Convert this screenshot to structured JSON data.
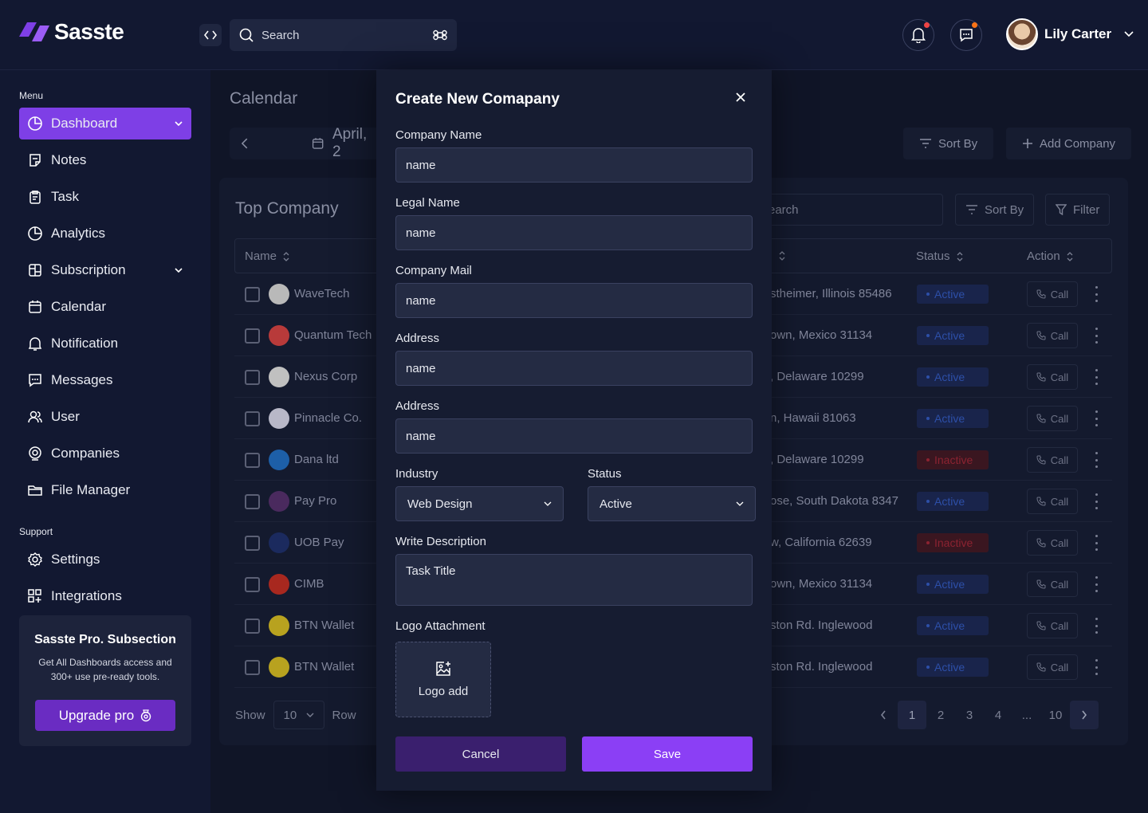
{
  "brand": {
    "name": "Sasste"
  },
  "header": {
    "search_placeholder": "Search",
    "user_name": "Lily Carter"
  },
  "sidebar": {
    "menu_label": "Menu",
    "items": [
      {
        "label": "Dashboard",
        "icon": "pie-chart-icon",
        "active": true,
        "chevron": true
      },
      {
        "label": "Notes",
        "icon": "note-icon"
      },
      {
        "label": "Task",
        "icon": "clipboard-icon"
      },
      {
        "label": "Analytics",
        "icon": "pie-chart-icon"
      },
      {
        "label": "Subscription",
        "icon": "layout-icon",
        "chevron": true
      },
      {
        "label": "Calendar",
        "icon": "calendar-icon"
      },
      {
        "label": "Notification",
        "icon": "bell-icon"
      },
      {
        "label": "Messages",
        "icon": "chat-icon"
      },
      {
        "label": "User",
        "icon": "users-icon"
      },
      {
        "label": "Companies",
        "icon": "building-icon"
      },
      {
        "label": "File Manager",
        "icon": "folder-icon"
      }
    ],
    "support_label": "Support",
    "support_items": [
      {
        "label": "Settings",
        "icon": "gear-icon"
      },
      {
        "label": "Integrations",
        "icon": "grid-plus-icon"
      }
    ],
    "promo": {
      "title": "Sasste Pro. Subsection",
      "description": "Get All Dashboards access and 300+ use pre-ready tools.",
      "button": "Upgrade pro"
    }
  },
  "main": {
    "title": "Calendar",
    "date": "April, 2",
    "sort_label": "Sort By",
    "add_label": "Add Company",
    "card": {
      "title": "Top Company",
      "search_placeholder": "earch",
      "sort_label": "Sort By",
      "filter_label": "Filter",
      "columns": {
        "name": "Name",
        "status": "Status",
        "action": "Action"
      },
      "call_label": "Call",
      "rows": [
        {
          "name": "WaveTech",
          "address": "stheimer, Illinois 85486",
          "status": "Active",
          "logo_color": "#b9b9b9"
        },
        {
          "name": "Quantum Tech",
          "address": "own, Mexico 31134",
          "status": "Active",
          "logo_color": "#b83a3a"
        },
        {
          "name": "Nexus Corp",
          "address": ", Delaware 10299",
          "status": "Active",
          "logo_color": "#c0c0c0"
        },
        {
          "name": "Pinnacle Co.",
          "address": "n, Hawaii 81063",
          "status": "Active",
          "logo_color": "#b8b8c8"
        },
        {
          "name": "Dana ltd",
          "address": ", Delaware 10299",
          "status": "Inactive",
          "logo_color": "#1d5fa8"
        },
        {
          "name": "Pay Pro",
          "address": "ose, South Dakota 8347",
          "status": "Active",
          "logo_color": "#4a2a5e"
        },
        {
          "name": "UOB Pay",
          "address": "w, California 62639",
          "status": "Inactive",
          "logo_color": "#1b2a5e"
        },
        {
          "name": "CIMB",
          "address": "own,  Mexico 31134",
          "status": "Active",
          "logo_color": "#a8281f"
        },
        {
          "name": "BTN Wallet",
          "address": "ston Rd. Inglewood",
          "status": "Active",
          "logo_color": "#b8a21f"
        },
        {
          "name": "BTN Wallet",
          "address": "ston Rd. Inglewood",
          "status": "Active",
          "logo_color": "#b8a21f"
        }
      ],
      "footer": {
        "show": "Show",
        "rows_value": "10",
        "row": "Row",
        "pages": [
          "1",
          "2",
          "3",
          "4",
          "...",
          "10"
        ],
        "current_page": "1"
      }
    }
  },
  "modal": {
    "title": "Create New Comapany",
    "fields": [
      {
        "label": "Company Name",
        "value": "name"
      },
      {
        "label": "Legal Name",
        "value": "name"
      },
      {
        "label": "Company Mail",
        "value": "name"
      },
      {
        "label": "Address",
        "value": "name"
      },
      {
        "label": "Address",
        "value": "name"
      }
    ],
    "industry": {
      "label": "Industry",
      "value": "Web Design"
    },
    "status": {
      "label": "Status",
      "value": "Active"
    },
    "description": {
      "label": "Write Description",
      "value": "Task Title"
    },
    "logo": {
      "label": "Logo Attachment",
      "button": "Logo add"
    },
    "cancel": "Cancel",
    "save": "Save"
  },
  "colors": {
    "accent": "#7e3fe6",
    "save": "#8b3ff5",
    "cancel": "#3a1f6e",
    "active": "#2d4fa8",
    "inactive": "#8c2331"
  }
}
